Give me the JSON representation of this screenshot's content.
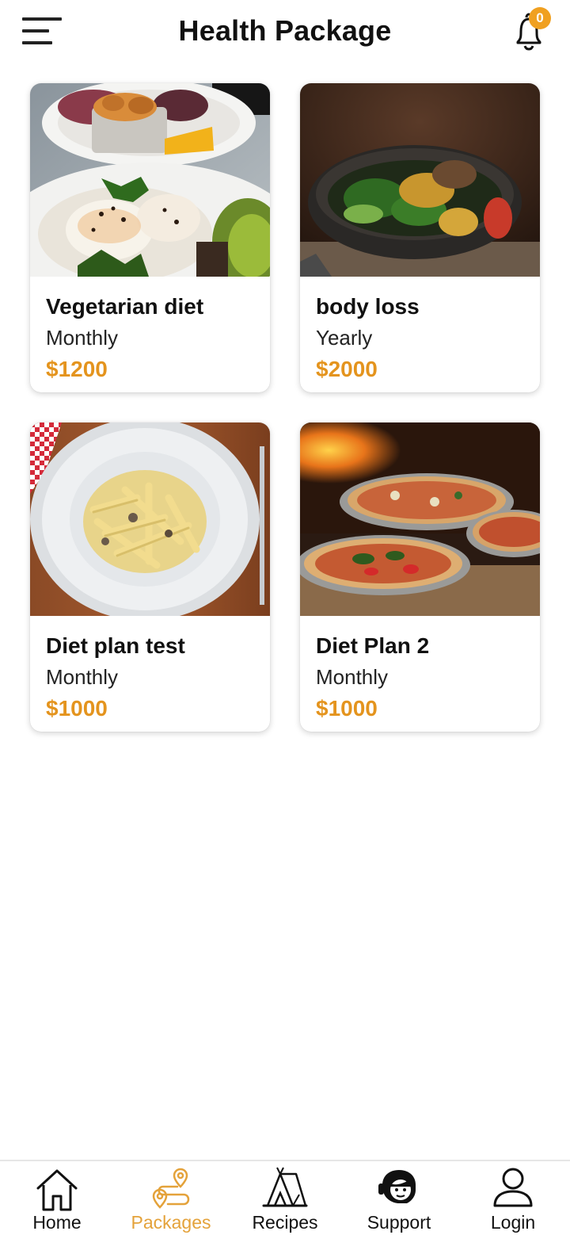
{
  "header": {
    "title": "Health Package",
    "notification_count": "0"
  },
  "packages": [
    {
      "title": "Vegetarian diet",
      "period": "Monthly",
      "price": "$1200",
      "image": "vegetarian-plate-image"
    },
    {
      "title": "body loss",
      "period": "Yearly",
      "price": "$2000",
      "image": "salad-bowl-image"
    },
    {
      "title": "Diet plan test",
      "period": "Monthly",
      "price": "$1000",
      "image": "pasta-plate-image"
    },
    {
      "title": "Diet Plan 2",
      "period": "Monthly",
      "price": "$1000",
      "image": "pizza-image"
    }
  ],
  "bottom_nav": {
    "active": "Packages",
    "items": [
      {
        "label": "Home",
        "icon": "home-icon"
      },
      {
        "label": "Packages",
        "icon": "route-pin-icon"
      },
      {
        "label": "Recipes",
        "icon": "tent-icon"
      },
      {
        "label": "Support",
        "icon": "headset-agent-icon"
      },
      {
        "label": "Login",
        "icon": "user-icon"
      }
    ]
  },
  "colors": {
    "accent": "#e4941e",
    "badge": "#f0a020",
    "text": "#111111"
  }
}
